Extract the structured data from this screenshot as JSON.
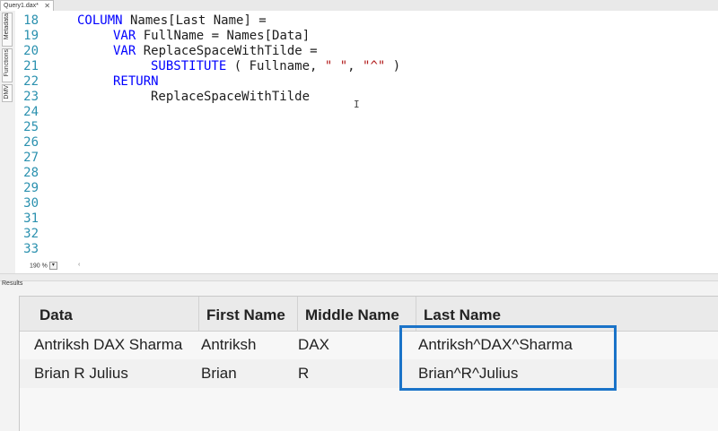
{
  "tab": {
    "title": "Query1.dax*",
    "close": "✕"
  },
  "side_tabs": [
    "Metadata",
    "Functions",
    "DMV"
  ],
  "editor": {
    "line_numbers": [
      "18",
      "19",
      "20",
      "21",
      "22",
      "23",
      "24",
      "25",
      "26",
      "27",
      "28",
      "29",
      "30",
      "31",
      "32",
      "33"
    ],
    "code": {
      "l18_kw": "COLUMN",
      "l18_rest": " Names[Last Name] =",
      "l19_kw": "VAR",
      "l19_rest": " FullName = Names[Data]",
      "l20_kw": "VAR",
      "l20_rest": " ReplaceSpaceWithTilde =",
      "l21_fn": "SUBSTITUTE",
      "l21_a": " ( Fullname, ",
      "l21_s1": "\" \"",
      "l21_b": ", ",
      "l21_s2": "\"^\"",
      "l21_c": " )",
      "l22_kw": "RETURN",
      "l23_rest": "ReplaceSpaceWithTilde"
    },
    "zoom": "190 %",
    "zoom_arrow": "▾"
  },
  "results": {
    "label": "Results",
    "columns": [
      "Data",
      "First Name",
      "Middle Name",
      "Last Name"
    ],
    "rows": [
      [
        "Antriksh DAX Sharma",
        "Antriksh",
        "DAX",
        "Antriksh^DAX^Sharma"
      ],
      [
        "Brian R Julius",
        "Brian",
        "R",
        "Brian^R^Julius"
      ]
    ],
    "highlight_color": "#1a73c8"
  }
}
